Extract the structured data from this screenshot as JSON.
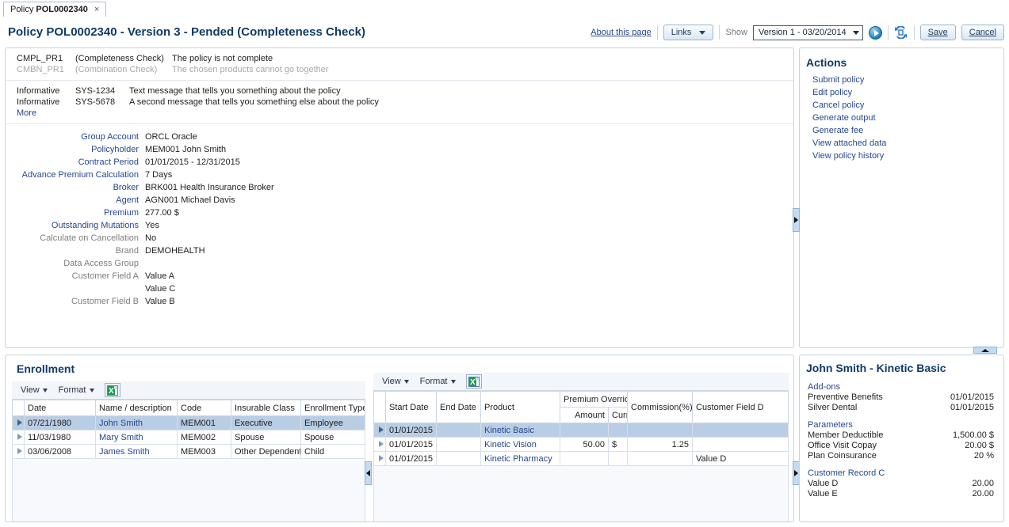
{
  "tab": {
    "prefix": "Policy",
    "id": "POL0002340",
    "close": "×"
  },
  "header": {
    "title": "Policy  POL0002340 - Version 3 -  Pended (Completeness Check)",
    "about_link": "About this page",
    "links_button": "Links",
    "show_label": "Show",
    "version_select": "Version 1 - 03/20/2014",
    "save_button": "Save",
    "cancel_button": "Cancel",
    "go_icon": "go-icon",
    "refresh_icon": "refresh-icon"
  },
  "messages": {
    "checks": [
      {
        "code": "CMPL_PR1",
        "kind": "(Completeness Check)",
        "text": "The policy is not complete",
        "dim": false
      },
      {
        "code": "CMBN_PR1",
        "kind": "(Combination Check)",
        "text": "The chosen products cannot go together",
        "dim": true
      }
    ],
    "info": [
      {
        "severity": "Informative",
        "code": "SYS-1234",
        "text": "Text message that tells you something about the policy"
      },
      {
        "severity": "Informative",
        "code": "SYS-5678",
        "text": "A second message that tells you something else about the policy"
      }
    ],
    "more_link": "More"
  },
  "details": [
    {
      "label": "Group Account",
      "value": "ORCL Oracle",
      "link": true
    },
    {
      "label": "Policyholder",
      "value": "MEM001 John Smith",
      "link": true
    },
    {
      "label": "Contract Period",
      "value": "01/01/2015 - 12/31/2015",
      "link": true
    },
    {
      "label": "Advance Premium Calculation",
      "value": "7 Days",
      "link": true
    },
    {
      "label": "Broker",
      "value": "BRK001 Health Insurance Broker",
      "link": true
    },
    {
      "label": "Agent",
      "value": "AGN001 Michael Davis",
      "link": true
    },
    {
      "label": "Premium",
      "value": "277.00 $",
      "link": true
    },
    {
      "label": "Outstanding Mutations",
      "value": "Yes",
      "link": true
    },
    {
      "label": "Calculate on Cancellation",
      "value": "No",
      "link": false
    },
    {
      "label": "Brand",
      "value": "DEMOHEALTH",
      "link": false
    },
    {
      "label": "Data Access Group",
      "value": "",
      "link": false
    },
    {
      "label": "Customer Field A",
      "value": "Value A",
      "link": false
    },
    {
      "label": "",
      "value": "Value C",
      "link": false
    },
    {
      "label": "Customer Field B",
      "value": "Value B",
      "link": false
    }
  ],
  "actions": {
    "title": "Actions",
    "items": [
      "Submit policy",
      "Edit policy",
      "Cancel policy",
      "Generate output",
      "Generate fee",
      "View attached data",
      "View policy history"
    ]
  },
  "enrollment": {
    "title": "Enrollment",
    "toolbar": {
      "view": "View",
      "format": "Format",
      "export_icon": "excel-export-icon"
    },
    "columns": [
      "Date",
      "Name / description",
      "Code",
      "Insurable Class",
      "Enrollment Type"
    ],
    "rows": [
      {
        "selected": true,
        "date": "07/21/1980",
        "name": "John Smith",
        "code": "MEM001",
        "insurable_class": "Executive",
        "enrollment_type": "Employee"
      },
      {
        "selected": false,
        "date": "11/03/1980",
        "name": "Mary Smith",
        "code": "MEM002",
        "insurable_class": "Spouse",
        "enrollment_type": "Spouse"
      },
      {
        "selected": false,
        "date": "03/06/2008",
        "name": "James Smith",
        "code": "MEM003",
        "insurable_class": "Other Dependent",
        "enrollment_type": "Child"
      }
    ]
  },
  "products": {
    "toolbar": {
      "view": "View",
      "format": "Format",
      "export_icon": "excel-export-icon"
    },
    "columns": {
      "start_date": "Start Date",
      "end_date": "End Date",
      "product": "Product",
      "premium_override": "Premium Override",
      "amount": "Amount",
      "curr": "Curr.",
      "commission": "Commission(%)",
      "customer_field_d": "Customer Field D"
    },
    "rows": [
      {
        "selected": true,
        "start_date": "01/01/2015",
        "end_date": "",
        "product": "Kinetic Basic",
        "amount": "",
        "curr": "",
        "commission": "",
        "customer_field_d": ""
      },
      {
        "selected": false,
        "start_date": "01/01/2015",
        "end_date": "",
        "product": "Kinetic Vision",
        "amount": "50.00",
        "curr": "$",
        "commission": "1.25",
        "customer_field_d": ""
      },
      {
        "selected": false,
        "start_date": "01/01/2015",
        "end_date": "",
        "product": "Kinetic Pharmacy",
        "amount": "",
        "curr": "",
        "commission": "",
        "customer_field_d": "Value D"
      }
    ]
  },
  "info_panel": {
    "title": "John Smith -  Kinetic Basic",
    "sections": [
      {
        "heading": "Add-ons",
        "rows": [
          {
            "k": "Preventive Benefits",
            "v": "01/01/2015"
          },
          {
            "k": "Silver Dental",
            "v": "01/01/2015"
          }
        ]
      },
      {
        "heading": "Parameters",
        "rows": [
          {
            "k": "Member Deductible",
            "v": "1,500.00 $"
          },
          {
            "k": "Office Visit Copay",
            "v": "20.00 $"
          },
          {
            "k": "Plan Coinsurance",
            "v": "20 %"
          }
        ]
      },
      {
        "heading": "Customer Record C",
        "rows": [
          {
            "k": "Value D",
            "v": "20.00"
          },
          {
            "k": "Value E",
            "v": "20.00"
          }
        ]
      }
    ]
  },
  "colors": {
    "title_blue": "#0f3b66",
    "link_blue": "#26478f",
    "selection": "#b9cde4",
    "panel_border": "#c6d3e0"
  }
}
